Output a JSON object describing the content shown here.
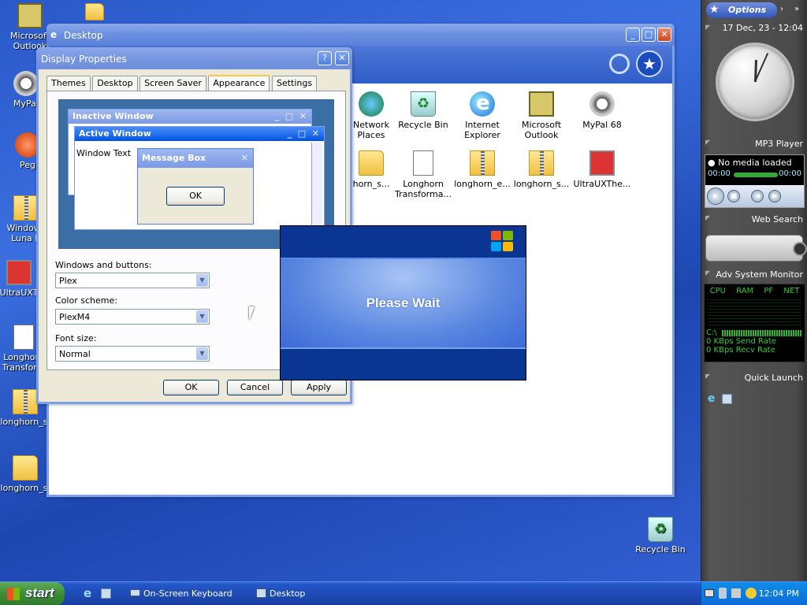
{
  "desktop_icons": [
    {
      "label": "Microsoft Outlook",
      "icon": "outlook-icon"
    },
    {
      "label": "MyPal",
      "icon": "mypal-icon"
    },
    {
      "label": "Peg",
      "icon": "app-icon"
    },
    {
      "label": "Windows Luna B",
      "icon": "zip-folder-icon"
    },
    {
      "label": "UltraUXT",
      "icon": "monitor-icon"
    },
    {
      "label": "Longhorn Transform",
      "icon": "document-icon"
    },
    {
      "label": "longhorn_sl",
      "icon": "zip-folder-icon"
    },
    {
      "label": "longhorn_sl",
      "icon": "folder-icon"
    },
    {
      "label": "Recycle Bin",
      "icon": "recycle-bin-icon"
    }
  ],
  "explorer": {
    "title": "Desktop",
    "items": [
      {
        "label": "Network Places",
        "icon": "network-icon"
      },
      {
        "label": "Recycle Bin",
        "icon": "recycle-bin-icon"
      },
      {
        "label": "Internet Explorer",
        "icon": "ie-icon"
      },
      {
        "label": "Microsoft Outlook",
        "icon": "outlook-icon"
      },
      {
        "label": "MyPal 68",
        "icon": "mypal-icon"
      },
      {
        "label": "horn_s...",
        "icon": "folder-icon"
      },
      {
        "label": "Longhorn Transforma...",
        "icon": "document-icon"
      },
      {
        "label": "longhorn_e...",
        "icon": "zip-folder-icon"
      },
      {
        "label": "longhorn_s...",
        "icon": "zip-folder-icon"
      },
      {
        "label": "UltraUXThe...",
        "icon": "monitor-icon"
      }
    ]
  },
  "display_properties": {
    "title": "Display Properties",
    "tabs": [
      "Themes",
      "Desktop",
      "Screen Saver",
      "Appearance",
      "Settings"
    ],
    "selected_tab": "Appearance",
    "preview": {
      "inactive_title": "Inactive Window",
      "active_title": "Active Window",
      "window_text": "Window Text",
      "message_title": "Message Box",
      "ok_label": "OK"
    },
    "windows_buttons_label": "Windows and buttons:",
    "windows_buttons_value": "Plex",
    "color_scheme_label": "Color scheme:",
    "color_scheme_value": "PlexM4",
    "font_size_label": "Font size:",
    "font_size_value": "Normal",
    "ok_label": "OK",
    "cancel_label": "Cancel",
    "apply_label": "Apply"
  },
  "please_wait": {
    "text": "Please Wait"
  },
  "sidebar": {
    "options_label": "Options",
    "date_time": "17 Dec, 23 - 12:04",
    "mp3_title": "MP3 Player",
    "mp3_status": "No media loaded",
    "mp3_time_start": "00:00",
    "mp3_time_end": "00:00",
    "web_search_title": "Web Search",
    "sysmon_title": "Adv System Monitor",
    "sysmon_cols": [
      "CPU",
      "RAM",
      "PF",
      "NET"
    ],
    "sysmon_drive": "C:\\",
    "send_rate": "0 KBps Send Rate",
    "recv_rate": "0 KBps Recv Rate",
    "quick_launch_title": "Quick Launch"
  },
  "taskbar": {
    "start_label": "start",
    "tasks": [
      "On-Screen Keyboard",
      "Desktop"
    ],
    "clock": "12:04 PM"
  }
}
